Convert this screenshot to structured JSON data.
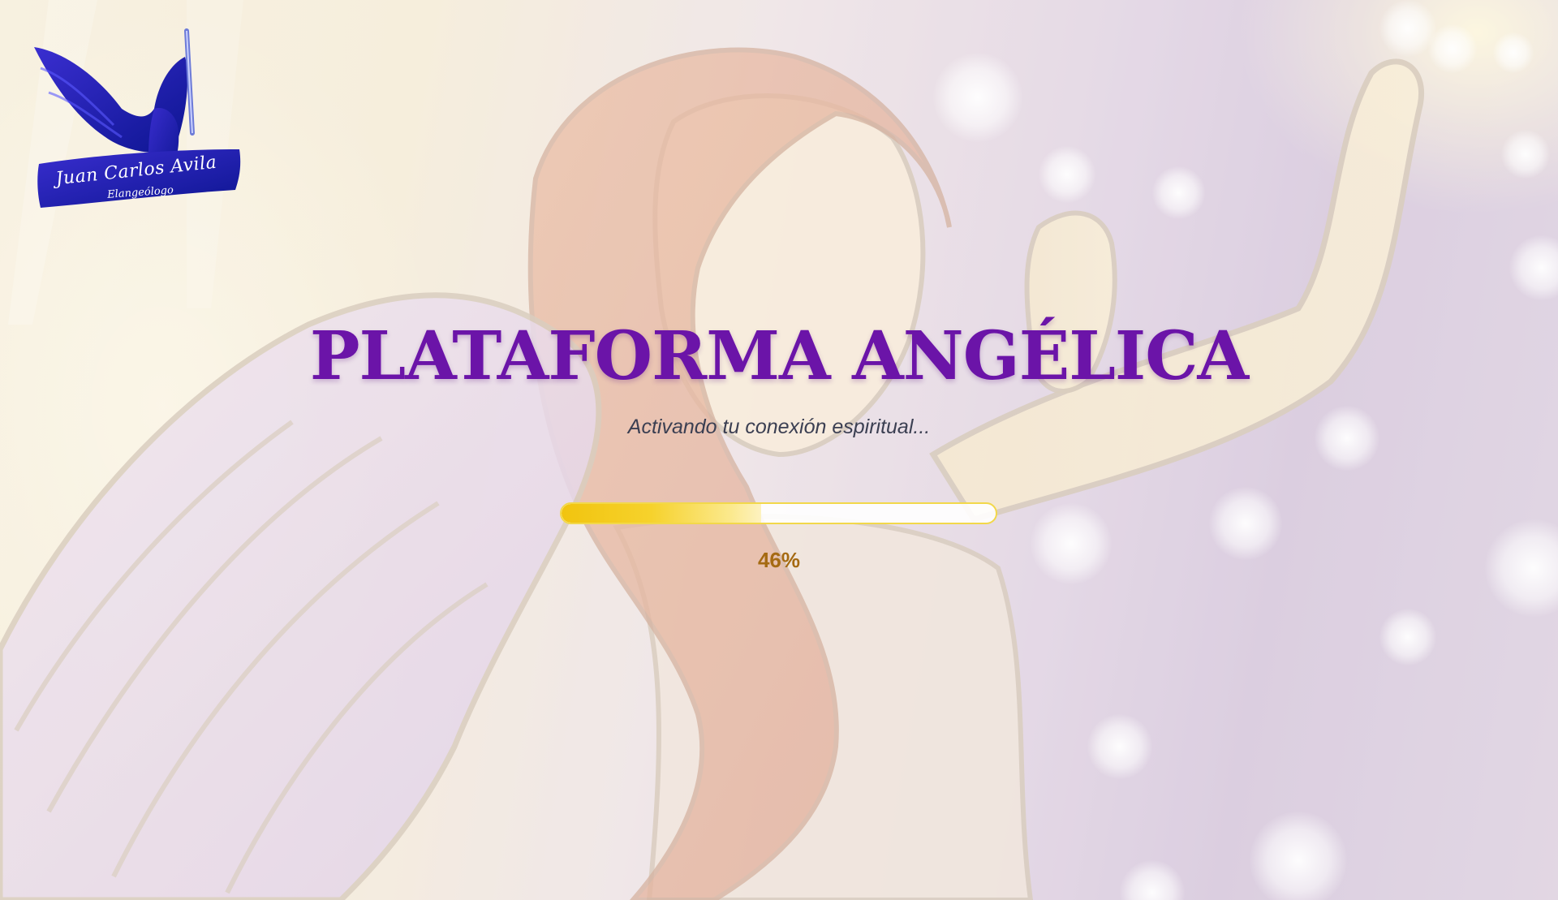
{
  "loader": {
    "title": "PLATAFORMA ANGÉLICA",
    "subtitle": "Activando tu conexión espiritual...",
    "progress": 0.46,
    "progress_label": "46%"
  },
  "logo": {
    "name": "Juan Carlos Avila",
    "tagline": "Elangeólogo"
  },
  "colors": {
    "title": "#6b14a8",
    "progress_fill": "#f1c40f",
    "progress_label": "#a56a12",
    "logo_blue": "#1a1ca8"
  },
  "icons": {
    "logo_emblem": "archangel-with-sword-icon"
  }
}
